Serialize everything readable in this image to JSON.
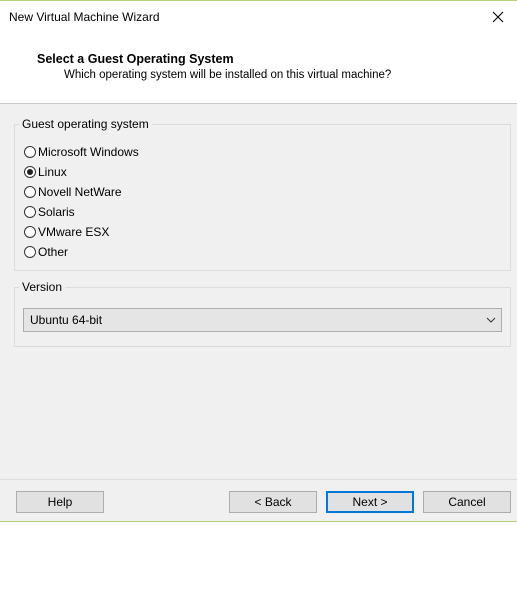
{
  "window": {
    "title": "New Virtual Machine Wizard",
    "close_icon": "close-icon"
  },
  "header": {
    "title": "Select a Guest Operating System",
    "subtitle": "Which operating system will be installed on this virtual machine?"
  },
  "os_group": {
    "label": "Guest operating system",
    "options": [
      {
        "label": "Microsoft Windows",
        "checked": false
      },
      {
        "label": "Linux",
        "checked": true
      },
      {
        "label": "Novell NetWare",
        "checked": false
      },
      {
        "label": "Solaris",
        "checked": false
      },
      {
        "label": "VMware ESX",
        "checked": false
      },
      {
        "label": "Other",
        "checked": false
      }
    ]
  },
  "version_group": {
    "label": "Version",
    "selected": "Ubuntu 64-bit"
  },
  "buttons": {
    "help": "Help",
    "back": "< Back",
    "next": "Next >",
    "cancel": "Cancel"
  },
  "colors": {
    "accent": "#0078d7",
    "border_accent": "#b5cf7d"
  }
}
